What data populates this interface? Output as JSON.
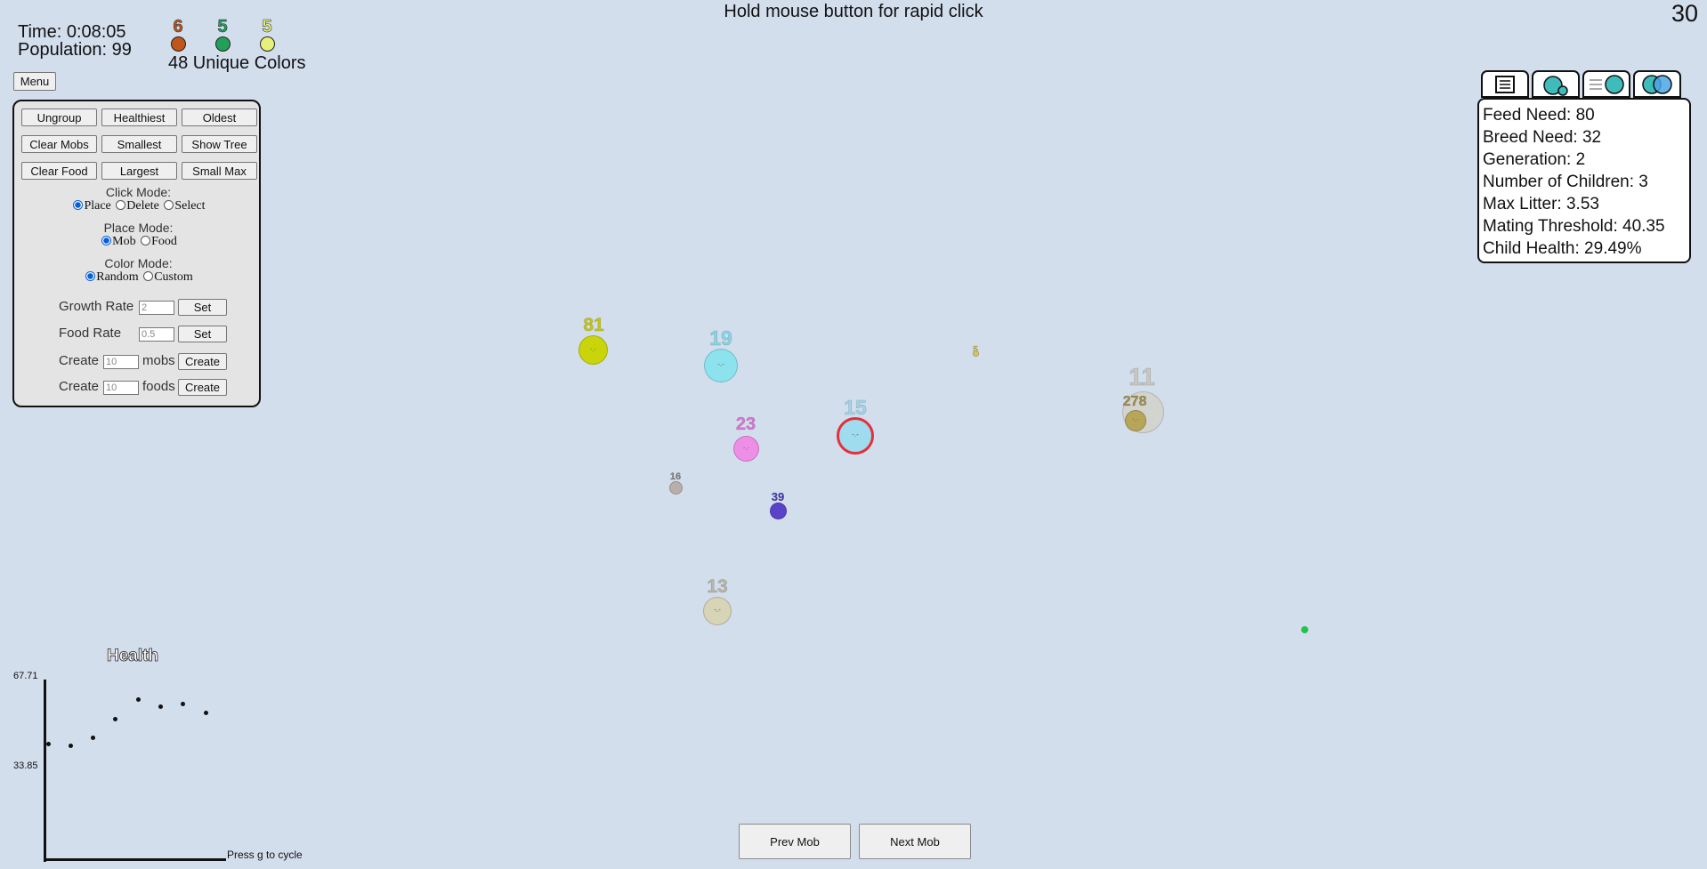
{
  "header": {
    "time": "Time: 0:08:05",
    "population": "Population: 99",
    "hint": "Hold mouse button for rapid click",
    "fps": "30",
    "unique_colors": "48 Unique Colors",
    "top_colors": [
      {
        "count": "6",
        "color": "#c0561a"
      },
      {
        "count": "5",
        "color": "#22a05a"
      },
      {
        "count": "5",
        "color": "#e6f07a"
      }
    ]
  },
  "menu_button": "Menu",
  "panel": {
    "buttons": [
      [
        "Ungroup",
        "Healthiest",
        "Oldest"
      ],
      [
        "Clear Mobs",
        "Smallest",
        "Show Tree"
      ],
      [
        "Clear Food",
        "Largest",
        "Small Max"
      ]
    ],
    "click_mode": {
      "title": "Click Mode:",
      "options": [
        "Place",
        "Delete",
        "Select"
      ],
      "selected": "Place"
    },
    "place_mode": {
      "title": "Place Mode:",
      "options": [
        "Mob",
        "Food"
      ],
      "selected": "Mob"
    },
    "color_mode": {
      "title": "Color Mode:",
      "options": [
        "Random",
        "Custom"
      ],
      "selected": "Random"
    },
    "growth_rate": {
      "label": "Growth Rate",
      "placeholder": "2",
      "button": "Set"
    },
    "food_rate": {
      "label": "Food Rate",
      "placeholder": "0.5",
      "button": "Set"
    },
    "create_mobs": {
      "label": "Create",
      "placeholder": "10",
      "suffix": "mobs",
      "button": "Create"
    },
    "create_foods": {
      "label": "Create",
      "placeholder": "10",
      "suffix": "foods",
      "button": "Create"
    }
  },
  "info": {
    "lines": [
      "Feed Need: 80",
      "Breed Need: 32",
      "Generation: 2",
      "Number of Children: 3",
      "Max Litter: 3.53",
      "Mating Threshold: 40.35",
      "Child Health: 29.49%"
    ]
  },
  "mobs": [
    {
      "label": "81",
      "color": "#c9d40a",
      "label_color": "#c3c816",
      "face": "·.·"
    },
    {
      "label": "19",
      "color": "#8ce3ee",
      "label_color": "#86d6e6",
      "face": "-.-"
    },
    {
      "label": "5",
      "color": "#d8c26a",
      "label_color": "#d4b84a",
      "face": ""
    },
    {
      "label": "15",
      "color": "#9fdcef",
      "label_color": "#9fd6ea",
      "face": "-.-",
      "selected": true
    },
    {
      "label": "23",
      "color": "#ee8ee6",
      "label_color": "#d978d2",
      "face": "·.·"
    },
    {
      "label": "11",
      "color": "#d2d2c8",
      "label_color": "#c8c8c0",
      "face": ""
    },
    {
      "label": "278",
      "color": "#b7a55a",
      "label_color": "#a0904e",
      "face": "·.·"
    },
    {
      "label": "16",
      "color": "#b8b0a8",
      "label_color": "#8a8480",
      "face": ""
    },
    {
      "label": "39",
      "color": "#5a43c8",
      "label_color": "#4a3db0",
      "face": ""
    },
    {
      "label": "13",
      "color": "#d8d4b8",
      "label_color": "#b8b6a8",
      "face": "-.-"
    }
  ],
  "food": [
    {
      "color": "#22c44a"
    }
  ],
  "graph": {
    "title": "Health",
    "ymax_label": "67.71",
    "ymid_label": "33.85",
    "hint": "Press g to cycle",
    "ymax": 67.71,
    "points": [
      46.0,
      45.2,
      48.5,
      56.0,
      63.8,
      60.8,
      62.0,
      58.3
    ]
  },
  "nav": {
    "prev": "Prev Mob",
    "next": "Next Mob"
  }
}
